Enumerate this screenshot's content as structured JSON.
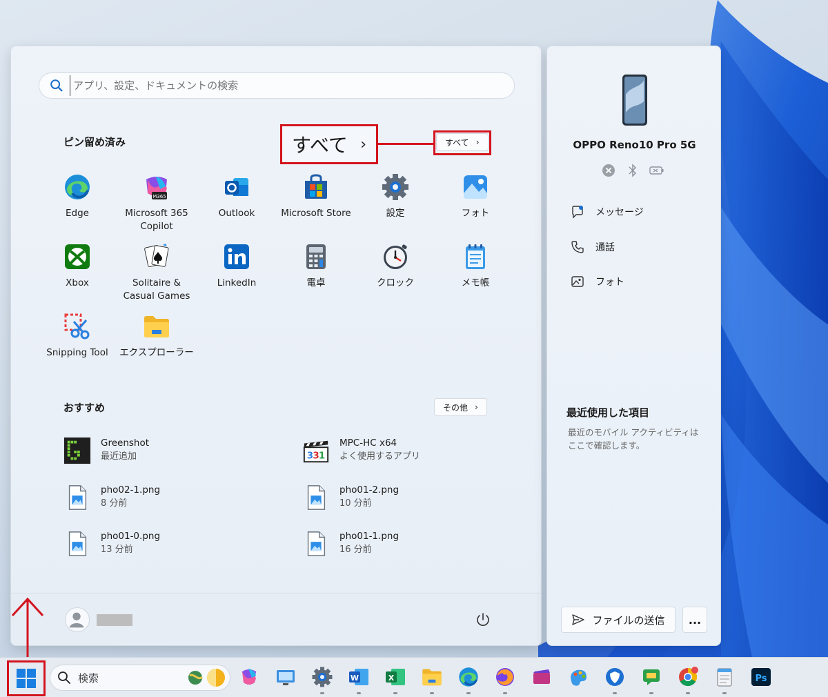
{
  "search": {
    "placeholder": "アプリ、設定、ドキュメントの検索"
  },
  "pinned": {
    "title": "ピン留め済み",
    "all_button_label": "すべて",
    "callout_label": "すべて",
    "apps": [
      {
        "label": "Edge",
        "icon": "edge-icon"
      },
      {
        "label": "Microsoft 365\nCopilot",
        "icon": "m365-copilot-icon"
      },
      {
        "label": "Outlook",
        "icon": "outlook-icon"
      },
      {
        "label": "Microsoft Store",
        "icon": "store-icon"
      },
      {
        "label": "設定",
        "icon": "settings-icon"
      },
      {
        "label": "フォト",
        "icon": "photos-icon"
      },
      {
        "label": "Xbox",
        "icon": "xbox-icon"
      },
      {
        "label": "Solitaire &\nCasual Games",
        "icon": "solitaire-icon"
      },
      {
        "label": "LinkedIn",
        "icon": "linkedin-icon"
      },
      {
        "label": "電卓",
        "icon": "calculator-icon"
      },
      {
        "label": "クロック",
        "icon": "clock-icon"
      },
      {
        "label": "メモ帳",
        "icon": "notepad-icon"
      },
      {
        "label": "Snipping Tool",
        "icon": "snipping-tool-icon"
      },
      {
        "label": "エクスプローラー",
        "icon": "explorer-icon"
      }
    ]
  },
  "recommended": {
    "title": "おすすめ",
    "more_label": "その他",
    "items": [
      {
        "name": "Greenshot",
        "sub": "最近追加",
        "icon": "greenshot-icon"
      },
      {
        "name": "MPC-HC x64",
        "sub": "よく使用するアプリ",
        "icon": "mpc-hc-icon"
      },
      {
        "name": "pho02-1.png",
        "sub": "8 分前",
        "icon": "image-file-icon"
      },
      {
        "name": "pho01-2.png",
        "sub": "10 分前",
        "icon": "image-file-icon"
      },
      {
        "name": "pho01-0.png",
        "sub": "13 分前",
        "icon": "image-file-icon"
      },
      {
        "name": "pho01-1.png",
        "sub": "16 分前",
        "icon": "image-file-icon"
      }
    ]
  },
  "phone": {
    "name": "OPPO Reno10 Pro 5G",
    "actions": [
      {
        "label": "メッセージ",
        "icon": "message-icon"
      },
      {
        "label": "通話",
        "icon": "phone-call-icon"
      },
      {
        "label": "フォト",
        "icon": "photo-icon"
      }
    ],
    "recent_title": "最近使用した項目",
    "recent_desc": "最近のモバイル アクティビティはここで確認します。",
    "send_label": "ファイルの送信",
    "more_label": "..."
  },
  "taskbar": {
    "search_label": "検索",
    "accent": "#d3141e"
  }
}
